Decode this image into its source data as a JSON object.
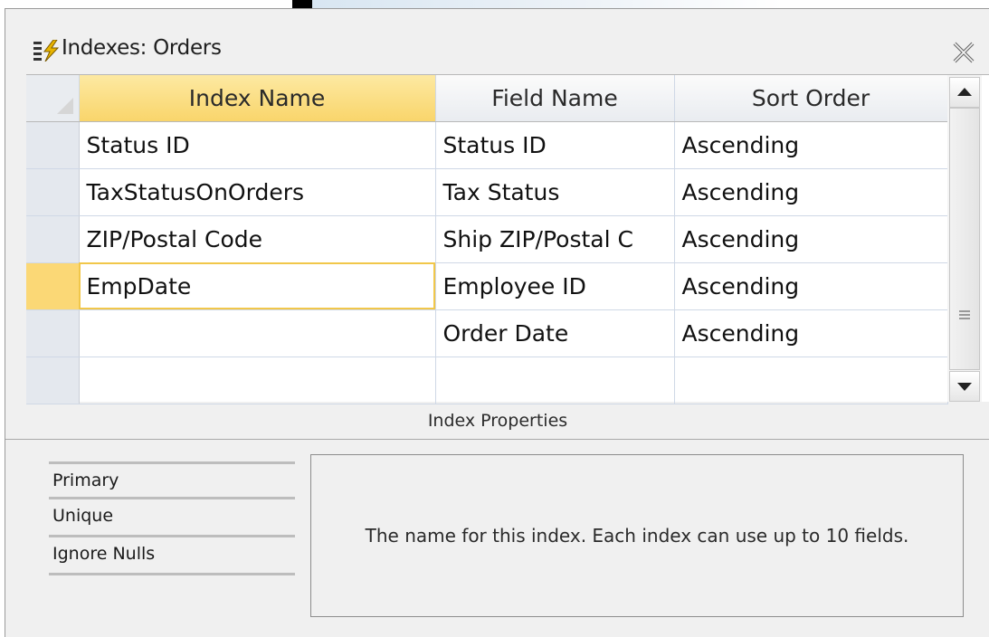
{
  "window": {
    "title": "Indexes: Orders",
    "icon": "indexes-icon",
    "close_icon": "close-icon"
  },
  "grid": {
    "columns": [
      "Index Name",
      "Field Name",
      "Sort Order"
    ],
    "rows": [
      {
        "index_name": "Status ID",
        "field_name": "Status ID",
        "sort_order": "Ascending"
      },
      {
        "index_name": "TaxStatusOnOrders",
        "field_name": "Tax Status",
        "sort_order": "Ascending"
      },
      {
        "index_name": "ZIP/Postal Code",
        "field_name": "Ship ZIP/Postal C",
        "sort_order": "Ascending"
      },
      {
        "index_name": "EmpDate",
        "field_name": "Employee ID",
        "sort_order": "Ascending"
      },
      {
        "index_name": "",
        "field_name": "Order Date",
        "sort_order": "Ascending"
      },
      {
        "index_name": "",
        "field_name": "",
        "sort_order": ""
      }
    ],
    "current_row": 3
  },
  "properties": {
    "header": "Index Properties",
    "items": [
      "Primary",
      "Unique",
      "Ignore Nulls"
    ],
    "description": "The name for this index.  Each index can use up to 10 fields."
  },
  "colors": {
    "active_header": "#f9d56b",
    "current_row_selector": "#fbd876",
    "focus_outline": "#f1c74a"
  }
}
